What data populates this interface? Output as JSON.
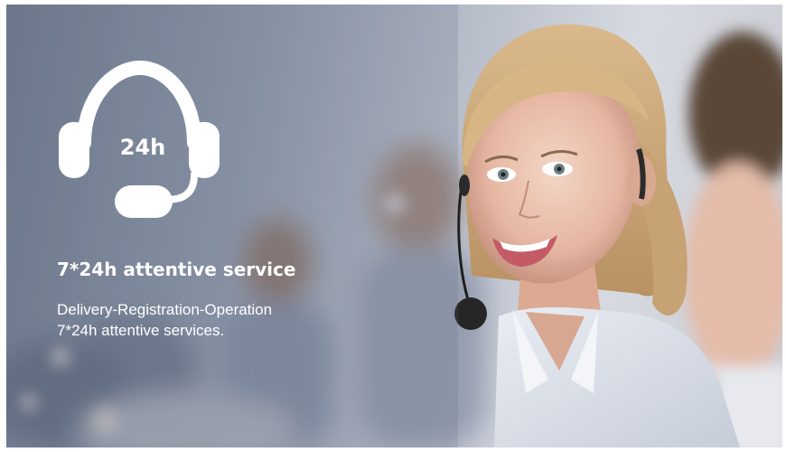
{
  "banner": {
    "icon_name": "headset-24h-icon",
    "icon_label": "24h",
    "title": "7*24h attentive service",
    "description_line1": "Delivery-Registration-Operation",
    "description_line2": "7*24h attentive services."
  },
  "colors": {
    "text": "#ffffff",
    "background_cool": "#7c879a",
    "background_light": "#d7dae1"
  }
}
